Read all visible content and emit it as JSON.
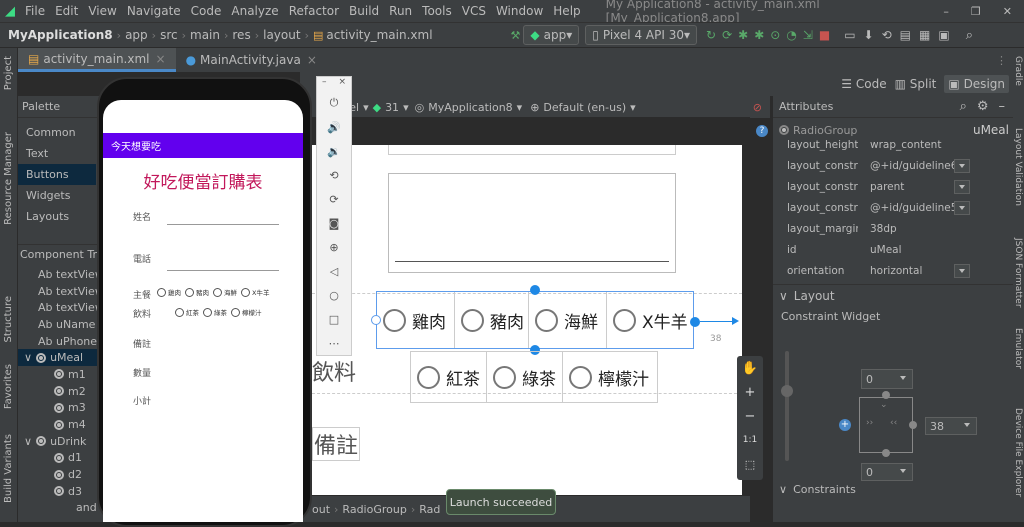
{
  "menu": [
    "File",
    "Edit",
    "View",
    "Navigate",
    "Code",
    "Analyze",
    "Refactor",
    "Build",
    "Run",
    "Tools",
    "VCS",
    "Window",
    "Help"
  ],
  "window_title": "My Application8 - activity_main.xml [My_Application8.app]",
  "breadcrumb": [
    "MyApplication8",
    "app",
    "src",
    "main",
    "res",
    "layout",
    "activity_main.xml"
  ],
  "run_config": "app",
  "device": "Pixel 4 API 30",
  "tabs": [
    "activity_main.xml",
    "MainActivity.java"
  ],
  "view_modes": [
    "Code",
    "Split",
    "Design"
  ],
  "left_strip": [
    "Project",
    "Resource Manager",
    "Structure",
    "Favorites",
    "Build Variants"
  ],
  "right_strip": [
    "Gradle",
    "Layout Validation",
    "JSON Formatter",
    "Emulator",
    "Device File Explorer"
  ],
  "palette": {
    "title": "Palette",
    "categories": [
      "Common",
      "Text",
      "Buttons",
      "Widgets",
      "Layouts"
    ],
    "selected": "Buttons"
  },
  "tree": {
    "title": "Component Tree",
    "rows": [
      "Ab textView",
      "Ab textView",
      "Ab textView",
      "Ab uName",
      "Ab uPhone",
      "uMeal",
      "m1",
      "m2",
      "m3",
      "m4",
      "uDrink",
      "d1",
      "d2",
      "d3",
      "and"
    ]
  },
  "design_toolbar": {
    "api": "31",
    "app": "MyApplication8",
    "locale": "Default (en-us)",
    "device_fragment": "ixel"
  },
  "attributes": {
    "title": "Attributes",
    "component": "RadioGroup",
    "component_id": "uMeal",
    "rows": [
      {
        "k": "layout_height",
        "v": "wrap_content"
      },
      {
        "k": "layout_constrain...",
        "v": "@+id/guideline6"
      },
      {
        "k": "layout_constrain...",
        "v": "parent"
      },
      {
        "k": "layout_constrain...",
        "v": "@+id/guideline5"
      },
      {
        "k": "layout_marginEnd",
        "v": "38dp"
      },
      {
        "k": "id",
        "v": "uMeal"
      },
      {
        "k": "orientation",
        "v": "horizontal"
      }
    ],
    "layout_section": "Layout",
    "constraint_widget": "Constraint Widget",
    "margins": {
      "top": "0",
      "bottom": "0",
      "right": "38"
    },
    "constraints_section": "Constraints"
  },
  "canvas": {
    "meal_options": [
      "雞肉",
      "豬肉",
      "海鮮",
      "X牛羊"
    ],
    "drink_options": [
      "紅茶",
      "綠茶",
      "檸檬汁"
    ],
    "left_labels": [
      "飲料",
      "備註"
    ],
    "margin_label": "38"
  },
  "phone_app": {
    "appbar": "今天想要吃",
    "title": "好吃便當訂購表",
    "name_label": "姓名",
    "phone_label": "電話",
    "meal_label": "主餐",
    "meal_options": [
      "雞肉",
      "豬肉",
      "海鮮",
      "X牛羊"
    ],
    "drink_label": "飲料",
    "drink_options": [
      "紅茶",
      "綠茶",
      "檸檬汁"
    ],
    "note_label": "備註",
    "qty_label": "數量",
    "subtotal_label": "小計"
  },
  "status": {
    "path": [
      "out",
      "RadioGroup",
      "Rad"
    ],
    "toast": "Launch succeeded"
  }
}
